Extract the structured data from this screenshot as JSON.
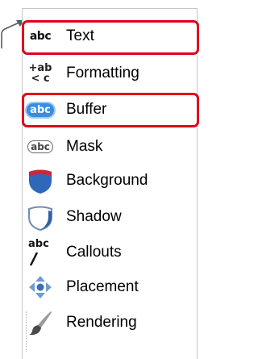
{
  "menu": {
    "items": [
      {
        "label": "Text",
        "icon": "abc-text-icon"
      },
      {
        "label": "Formatting",
        "icon": "formatting-icon"
      },
      {
        "label": "Buffer",
        "icon": "buffer-icon"
      },
      {
        "label": "Mask",
        "icon": "mask-icon"
      },
      {
        "label": "Background",
        "icon": "background-icon"
      },
      {
        "label": "Shadow",
        "icon": "shadow-icon"
      },
      {
        "label": "Callouts",
        "icon": "callouts-icon"
      },
      {
        "label": "Placement",
        "icon": "placement-icon"
      },
      {
        "label": "Rendering",
        "icon": "rendering-icon"
      }
    ],
    "icon_glyphs": {
      "abc_text": "abc",
      "formatting_top": "+ab",
      "formatting_bottom": "< c",
      "buffer": "abc",
      "mask": "abc",
      "callouts": "abc"
    },
    "highlighted": [
      "Text",
      "Buffer"
    ]
  },
  "colors": {
    "highlight": "#e0001b",
    "background_shield": "#2f68b8",
    "background_top": "#c8283a",
    "arrow": "#555b66"
  }
}
